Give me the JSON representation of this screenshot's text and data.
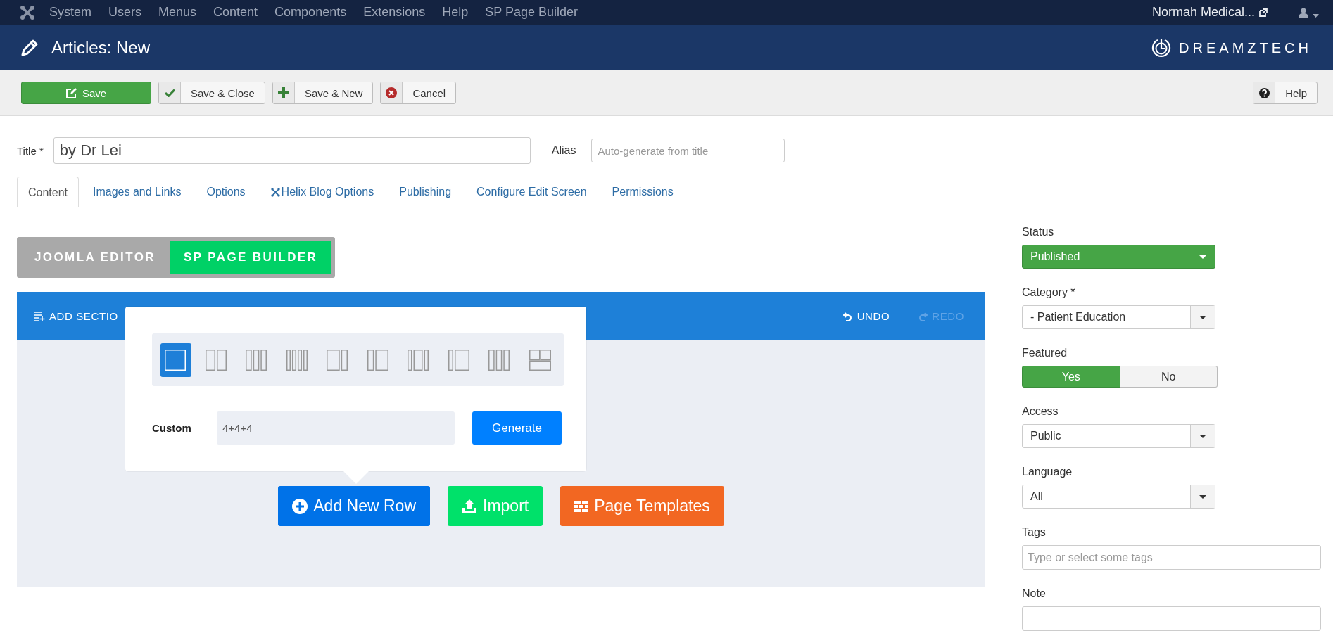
{
  "topnav": {
    "menu": [
      "System",
      "Users",
      "Menus",
      "Content",
      "Components",
      "Extensions",
      "Help",
      "SP Page Builder"
    ],
    "site_link": "Normah Medical..."
  },
  "header": {
    "title": "Articles: New",
    "brand": "DREAMZTECH"
  },
  "toolbar": {
    "buttons": [
      {
        "label": "Save",
        "kind": "primary"
      },
      {
        "label": "Save & Close",
        "kind": "default"
      },
      {
        "label": "Save & New",
        "kind": "default"
      },
      {
        "label": "Cancel",
        "kind": "default"
      }
    ],
    "help": "Help"
  },
  "title_field": {
    "label": "Title *",
    "value": "by Dr Lei"
  },
  "alias_field": {
    "label": "Alias",
    "placeholder": "Auto-generate from title"
  },
  "tabs": [
    {
      "label": "Content",
      "selected": true
    },
    {
      "label": "Images and Links",
      "selected": false
    },
    {
      "label": "Options",
      "selected": false
    },
    {
      "label": "Helix Blog Options",
      "selected": false
    },
    {
      "label": "Publishing",
      "selected": false
    },
    {
      "label": "Configure Edit Screen",
      "selected": false
    },
    {
      "label": "Permissions",
      "selected": false
    }
  ],
  "editor_switch": [
    {
      "label": "JOOMLA EDITOR",
      "selected": false
    },
    {
      "label": "SP PAGE BUILDER",
      "selected": true
    }
  ],
  "builder": {
    "add_section": "ADD SECTIO",
    "undo": {
      "label": "UNDO",
      "disabled": false
    },
    "redo": {
      "label": "REDO",
      "disabled": true
    },
    "layout_popup": {
      "layouts": [
        {
          "selected": true
        },
        {
          "selected": false
        },
        {
          "selected": false
        },
        {
          "selected": false
        },
        {
          "selected": false
        },
        {
          "selected": false
        },
        {
          "selected": false
        },
        {
          "selected": false
        },
        {
          "selected": false
        },
        {
          "selected": false
        }
      ],
      "custom_label": "Custom",
      "custom_value": "4+4+4",
      "generate": "Generate"
    },
    "actions": [
      {
        "label": "Add New Row",
        "kind": "primary"
      },
      {
        "label": "Import",
        "kind": "success"
      },
      {
        "label": "Page Templates",
        "kind": "warning"
      }
    ]
  },
  "sidebar": [
    {
      "label": "Status",
      "kind": "status-select",
      "value": "Published"
    },
    {
      "label": "Category *",
      "kind": "select",
      "value": "- Patient Education"
    },
    {
      "label": "Featured",
      "kind": "toggle",
      "options": [
        {
          "label": "Yes",
          "selected": true
        },
        {
          "label": "No",
          "selected": false
        }
      ]
    },
    {
      "label": "Access",
      "kind": "select",
      "value": "Public"
    },
    {
      "label": "Language",
      "kind": "select",
      "value": "All"
    },
    {
      "label": "Tags",
      "kind": "text",
      "placeholder": "Type or select some tags"
    },
    {
      "label": "Note",
      "kind": "text"
    }
  ]
}
